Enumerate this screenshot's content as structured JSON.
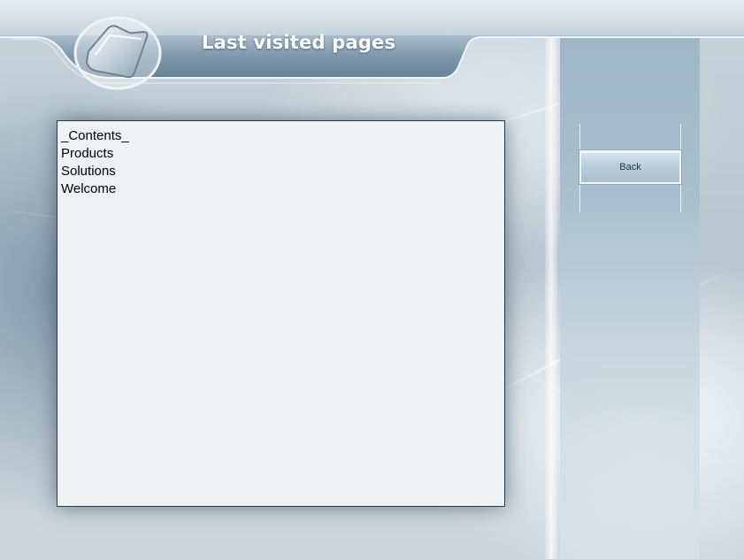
{
  "header": {
    "title": "Last visited pages"
  },
  "history": {
    "items": [
      {
        "label": "_Contents_"
      },
      {
        "label": "Products"
      },
      {
        "label": "Solutions"
      },
      {
        "label": "Welcome"
      }
    ]
  },
  "sidebar": {
    "back_label": "Back"
  },
  "icons": {
    "header_icon": "folder-icon"
  },
  "colors": {
    "title_text": "#ffffff",
    "list_background": "#eef2f5",
    "button_background": "#b9ccda",
    "panel_background": "#a9bfcd"
  }
}
